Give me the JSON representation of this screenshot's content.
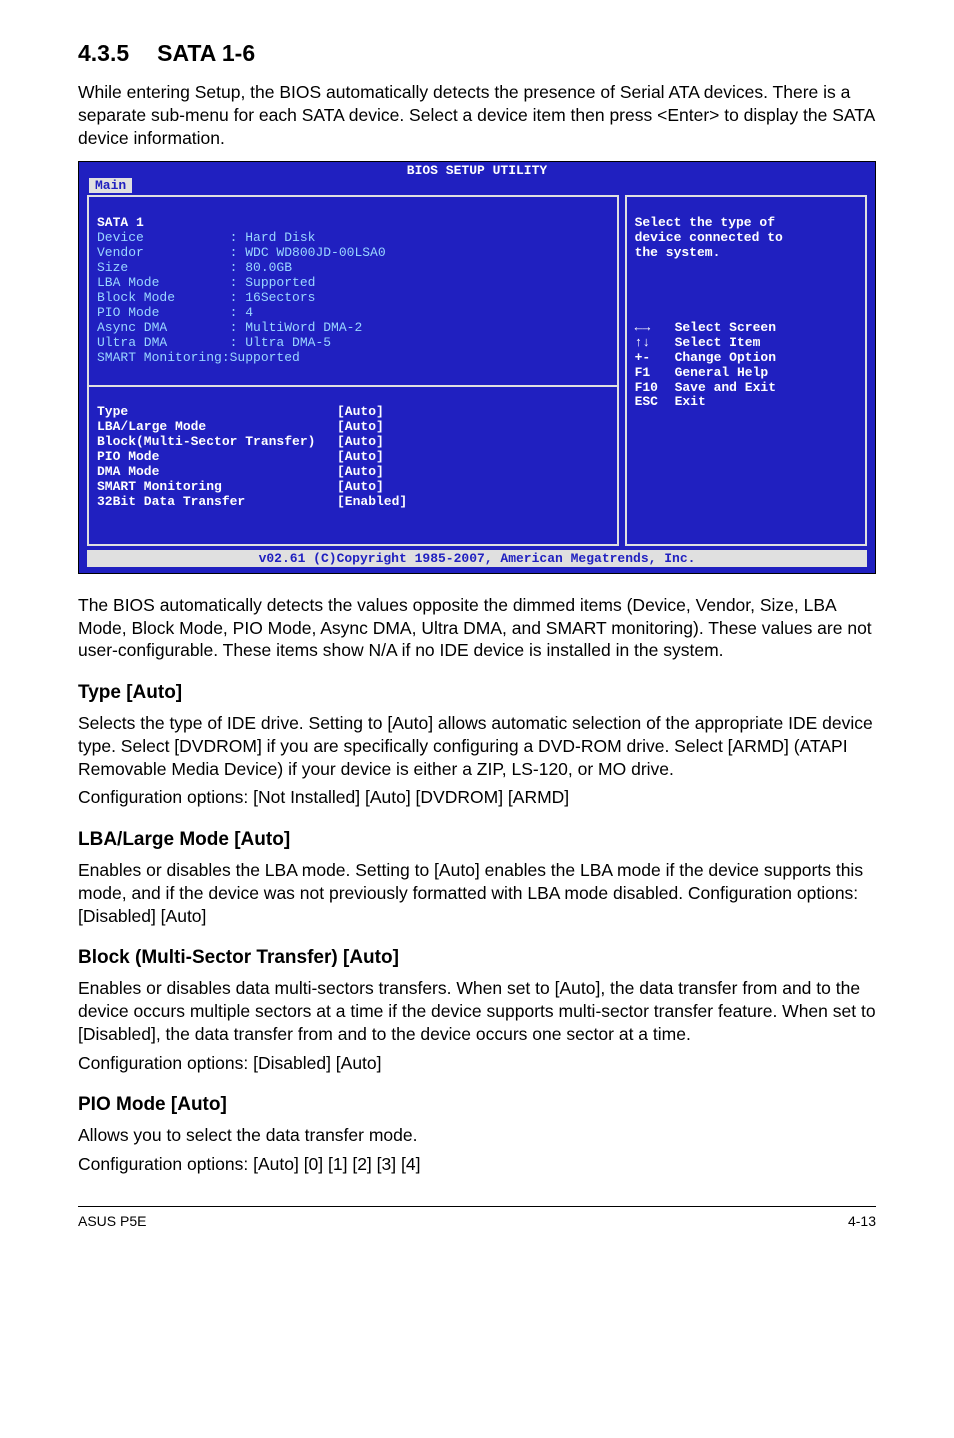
{
  "section": {
    "number": "4.3.5",
    "title": "SATA 1-6"
  },
  "intro": "While entering Setup, the BIOS automatically detects the presence of Serial ATA devices. There is a separate sub-menu for each SATA device. Select a device item then press <Enter> to display the SATA device information.",
  "bios": {
    "title": "BIOS SETUP UTILITY",
    "tab": "Main",
    "left": {
      "header": "SATA 1",
      "dim_rows": [
        {
          "k": "Device",
          "v": ": Hard Disk"
        },
        {
          "k": "Vendor",
          "v": ": WDC WD800JD-00LSA0"
        },
        {
          "k": "Size",
          "v": ": 80.0GB"
        },
        {
          "k": "LBA Mode",
          "v": ": Supported"
        },
        {
          "k": "Block Mode",
          "v": ": 16Sectors"
        },
        {
          "k": "PIO Mode",
          "v": ": 4"
        },
        {
          "k": "Async DMA",
          "v": ": MultiWord DMA-2"
        },
        {
          "k": "Ultra DMA",
          "v": ": Ultra DMA-5"
        },
        {
          "k": "SMART Monitoring:",
          "v": "Supported"
        }
      ],
      "cfg_rows": [
        {
          "k": "Type",
          "v": "[Auto]"
        },
        {
          "k": "LBA/Large Mode",
          "v": "[Auto]"
        },
        {
          "k": "Block(Multi-Sector Transfer)",
          "v": "[Auto]"
        },
        {
          "k": "PIO Mode",
          "v": "[Auto]"
        },
        {
          "k": "DMA Mode",
          "v": "[Auto]"
        },
        {
          "k": "SMART Monitoring",
          "v": "[Auto]"
        },
        {
          "k": "32Bit Data Transfer",
          "v": "[Enabled]"
        }
      ]
    },
    "right": {
      "help": "Select the type of\ndevice connected to\nthe system.",
      "nav": [
        {
          "sym": "←→",
          "label": "Select Screen"
        },
        {
          "sym": "↑↓",
          "label": "Select Item"
        },
        {
          "sym": "+-",
          "label": "Change Option"
        },
        {
          "sym": "F1",
          "label": "General Help"
        },
        {
          "sym": "F10",
          "label": "Save and Exit"
        },
        {
          "sym": "ESC",
          "label": "Exit"
        }
      ]
    },
    "footer": "v02.61 (C)Copyright 1985-2007, American Megatrends, Inc."
  },
  "after_bios": "The BIOS automatically detects the values opposite the dimmed items (Device, Vendor, Size, LBA Mode, Block Mode, PIO Mode, Async DMA, Ultra DMA, and SMART monitoring). These values are not user-configurable. These items show N/A if no IDE device is installed in the system.",
  "sections": [
    {
      "title": "Type [Auto]",
      "paras": [
        "Selects the type of IDE drive. Setting to [Auto] allows automatic selection of the appropriate IDE device type. Select [DVDROM] if you are specifically configuring a DVD-ROM drive. Select [ARMD] (ATAPI Removable Media Device) if your device is either a ZIP, LS-120, or MO drive.",
        "Configuration options: [Not Installed] [Auto] [DVDROM] [ARMD]"
      ]
    },
    {
      "title": "LBA/Large Mode [Auto]",
      "paras": [
        "Enables or disables the LBA mode. Setting to [Auto] enables the LBA mode if the device supports this mode, and if the device was not previously formatted with LBA mode disabled. Configuration options: [Disabled] [Auto]"
      ]
    },
    {
      "title": "Block (Multi-Sector Transfer) [Auto]",
      "paras": [
        "Enables or disables data multi-sectors transfers. When set to [Auto], the data transfer from and to the device occurs multiple sectors at a time if the device supports multi-sector transfer feature. When set to [Disabled], the data transfer from and to the device occurs one sector at a time.",
        "Configuration options: [Disabled] [Auto]"
      ]
    },
    {
      "title": "PIO Mode [Auto]",
      "paras": [
        "Allows you to select the data transfer mode.",
        "Configuration options: [Auto] [0] [1] [2] [3] [4]"
      ]
    }
  ],
  "footer": {
    "left": "ASUS P5E",
    "right": "4-13"
  }
}
